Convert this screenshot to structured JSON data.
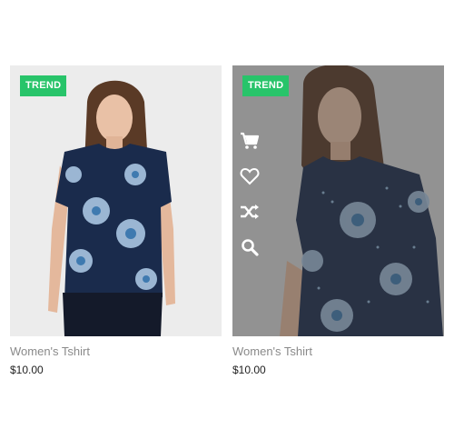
{
  "products": [
    {
      "badge": "TREND",
      "title": "Women's Tshirt",
      "price": "$10.00"
    },
    {
      "badge": "TREND",
      "title": "Women's Tshirt",
      "price": "$10.00",
      "actions": [
        "cart-icon",
        "heart-icon",
        "shuffle-icon",
        "search-icon"
      ]
    }
  ],
  "colors": {
    "badge": "#28c46a",
    "title": "#8a8a8a",
    "price": "#222222",
    "shirt": "#1a2b4c",
    "overlay": "#3c3c3c"
  }
}
